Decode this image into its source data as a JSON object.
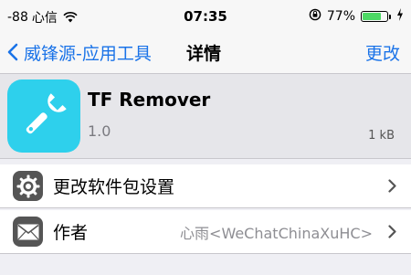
{
  "status_bar": {
    "signal": "-88",
    "carrier": "心信",
    "time": "07:35",
    "battery_percent": "77%",
    "battery_level": 0.77,
    "icons": [
      "wifi-icon",
      "rotation-lock-icon",
      "battery-icon",
      "charging-icon"
    ]
  },
  "nav": {
    "back_label": "威锋源-应用工具",
    "title": "详情",
    "right_action": "更改",
    "tint_color": "#1a73e8"
  },
  "package": {
    "name": "TF Remover",
    "version": "1.0",
    "size": "1 kB",
    "icon": "wrench-icon",
    "icon_color": "#2ed0ec"
  },
  "rows": [
    {
      "label": "更改软件包设置",
      "value": "",
      "icon": "gear-icon"
    },
    {
      "label": "作者",
      "value": "心雨<WeChatChinaXuHC>",
      "icon": "mail-icon"
    }
  ]
}
